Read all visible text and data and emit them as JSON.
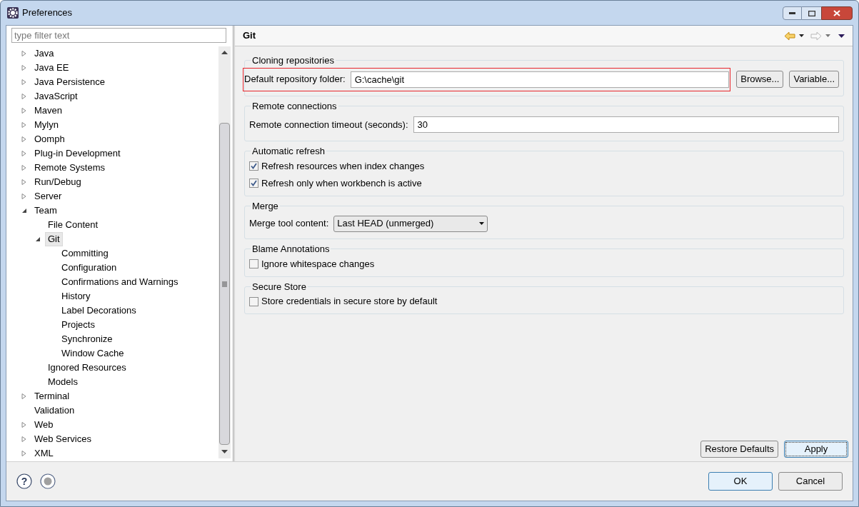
{
  "window": {
    "title": "Preferences"
  },
  "filter": {
    "placeholder": "type filter text"
  },
  "tree": [
    {
      "label": "Java",
      "expandable": true,
      "expanded": false,
      "selected": false
    },
    {
      "label": "Java EE",
      "expandable": true,
      "expanded": false,
      "selected": false
    },
    {
      "label": "Java Persistence",
      "expandable": true,
      "expanded": false,
      "selected": false
    },
    {
      "label": "JavaScript",
      "expandable": true,
      "expanded": false,
      "selected": false
    },
    {
      "label": "Maven",
      "expandable": true,
      "expanded": false,
      "selected": false
    },
    {
      "label": "Mylyn",
      "expandable": true,
      "expanded": false,
      "selected": false
    },
    {
      "label": "Oomph",
      "expandable": true,
      "expanded": false,
      "selected": false
    },
    {
      "label": "Plug-in Development",
      "expandable": true,
      "expanded": false,
      "selected": false
    },
    {
      "label": "Remote Systems",
      "expandable": true,
      "expanded": false,
      "selected": false
    },
    {
      "label": "Run/Debug",
      "expandable": true,
      "expanded": false,
      "selected": false
    },
    {
      "label": "Server",
      "expandable": true,
      "expanded": false,
      "selected": false
    },
    {
      "label": "Team",
      "expandable": true,
      "expanded": true,
      "selected": false,
      "children": [
        {
          "label": "File Content",
          "expandable": false,
          "selected": false
        },
        {
          "label": "Git",
          "expandable": true,
          "expanded": true,
          "selected": true,
          "children": [
            {
              "label": "Committing",
              "expandable": false,
              "selected": false
            },
            {
              "label": "Configuration",
              "expandable": false,
              "selected": false
            },
            {
              "label": "Confirmations and Warnings",
              "expandable": false,
              "selected": false
            },
            {
              "label": "History",
              "expandable": false,
              "selected": false
            },
            {
              "label": "Label Decorations",
              "expandable": false,
              "selected": false
            },
            {
              "label": "Projects",
              "expandable": false,
              "selected": false
            },
            {
              "label": "Synchronize",
              "expandable": false,
              "selected": false
            },
            {
              "label": "Window Cache",
              "expandable": false,
              "selected": false
            }
          ]
        },
        {
          "label": "Ignored Resources",
          "expandable": false,
          "selected": false
        },
        {
          "label": "Models",
          "expandable": false,
          "selected": false
        }
      ]
    },
    {
      "label": "Terminal",
      "expandable": true,
      "expanded": false,
      "selected": false
    },
    {
      "label": "Validation",
      "expandable": false,
      "selected": false
    },
    {
      "label": "Web",
      "expandable": true,
      "expanded": false,
      "selected": false
    },
    {
      "label": "Web Services",
      "expandable": true,
      "expanded": false,
      "selected": false
    },
    {
      "label": "XML",
      "expandable": true,
      "expanded": false,
      "selected": false
    }
  ],
  "page": {
    "title": "Git",
    "groups": [
      {
        "title": "Cloning repositories",
        "rows": [
          {
            "kind": "text",
            "label": "Default repository folder:",
            "value": "G:\\cache\\git",
            "highlighted": true,
            "buttons": [
              {
                "label": "Browse..."
              },
              {
                "label": "Variable..."
              }
            ]
          }
        ]
      },
      {
        "title": "Remote connections",
        "rows": [
          {
            "kind": "text",
            "label": "Remote connection timeout (seconds):",
            "value": "30",
            "highlighted": false
          }
        ]
      },
      {
        "title": "Automatic refresh",
        "rows": [
          {
            "kind": "checkbox",
            "label": "Refresh resources when index changes",
            "checked": true
          },
          {
            "kind": "checkbox",
            "label": "Refresh only when workbench is active",
            "checked": true
          }
        ]
      },
      {
        "title": "Merge",
        "rows": [
          {
            "kind": "select",
            "label": "Merge tool content:",
            "value": "Last HEAD (unmerged)"
          }
        ]
      },
      {
        "title": "Blame Annotations",
        "rows": [
          {
            "kind": "checkbox",
            "label": "Ignore whitespace changes",
            "checked": false
          }
        ]
      },
      {
        "title": "Secure Store",
        "rows": [
          {
            "kind": "checkbox",
            "label": "Store credentials in secure store by default",
            "checked": false
          }
        ]
      }
    ],
    "buttons": [
      {
        "label": "Restore Defaults",
        "default": false
      },
      {
        "label": "Apply",
        "default": true
      }
    ]
  },
  "footer": {
    "help": "?"
  },
  "dialog_buttons": [
    {
      "label": "OK",
      "default": true
    },
    {
      "label": "Cancel",
      "default": false
    }
  ]
}
